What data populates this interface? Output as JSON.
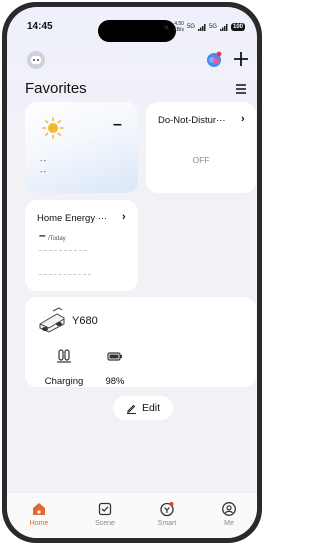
{
  "status_bar": {
    "time": "14:45",
    "net1": "4.50",
    "net1_unit": "KB/s",
    "sig1": "5G",
    "sig2": "5G",
    "battery": "100"
  },
  "header": {
    "title": "Favorites"
  },
  "weather_card": {
    "temperature": "–",
    "line1": "--",
    "line2": "--"
  },
  "dnd_card": {
    "title": "Do-Not-Distur···",
    "value": "OFF"
  },
  "energy_card": {
    "title": "Home Energy ···",
    "value": "–",
    "unit": "/Today"
  },
  "device_card": {
    "name": "Y680",
    "status_label": "Charging",
    "battery_label": "98%"
  },
  "edit_button": {
    "label": "Edit"
  },
  "tabbar": {
    "tabs": [
      {
        "label": "Home"
      },
      {
        "label": "Scene"
      },
      {
        "label": "Smart"
      },
      {
        "label": "Me"
      }
    ]
  },
  "colors": {
    "accent": "#e0672e",
    "inactive": "#8a8a8a",
    "background": "#f2f2f6"
  }
}
